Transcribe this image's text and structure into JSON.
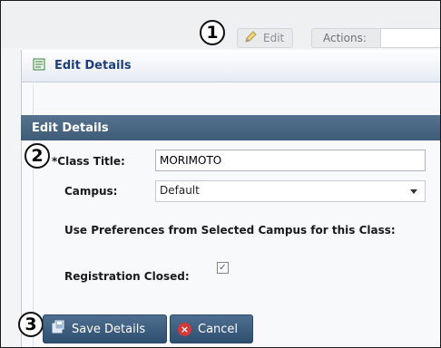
{
  "toolbar": {
    "edit_label": "Edit",
    "actions_label": "Actions:",
    "actions_value": ""
  },
  "callouts": [
    "1",
    "2",
    "3"
  ],
  "dialog": {
    "title": "Edit Details",
    "section_title": "Edit Details"
  },
  "form": {
    "class_title_label": "*Class Title:",
    "class_title_value": "MORIMOTO",
    "campus_label": "Campus:",
    "campus_value": "Default",
    "use_prefs_label": "Use Preferences from Selected Campus for this Class:",
    "registration_closed_label": "Registration Closed:",
    "registration_closed_checked": "✓"
  },
  "buttons": {
    "save": "Save Details",
    "cancel": "Cancel"
  },
  "colors": {
    "section_header": "#4a6886",
    "button_blue": "#3d5d7f",
    "title_blue": "#1d3f7a",
    "cancel_red": "#d23a3a"
  },
  "icons": [
    "pencil-icon",
    "form-icon",
    "save-icon",
    "cancel-icon",
    "dropdown-caret-icon"
  ]
}
